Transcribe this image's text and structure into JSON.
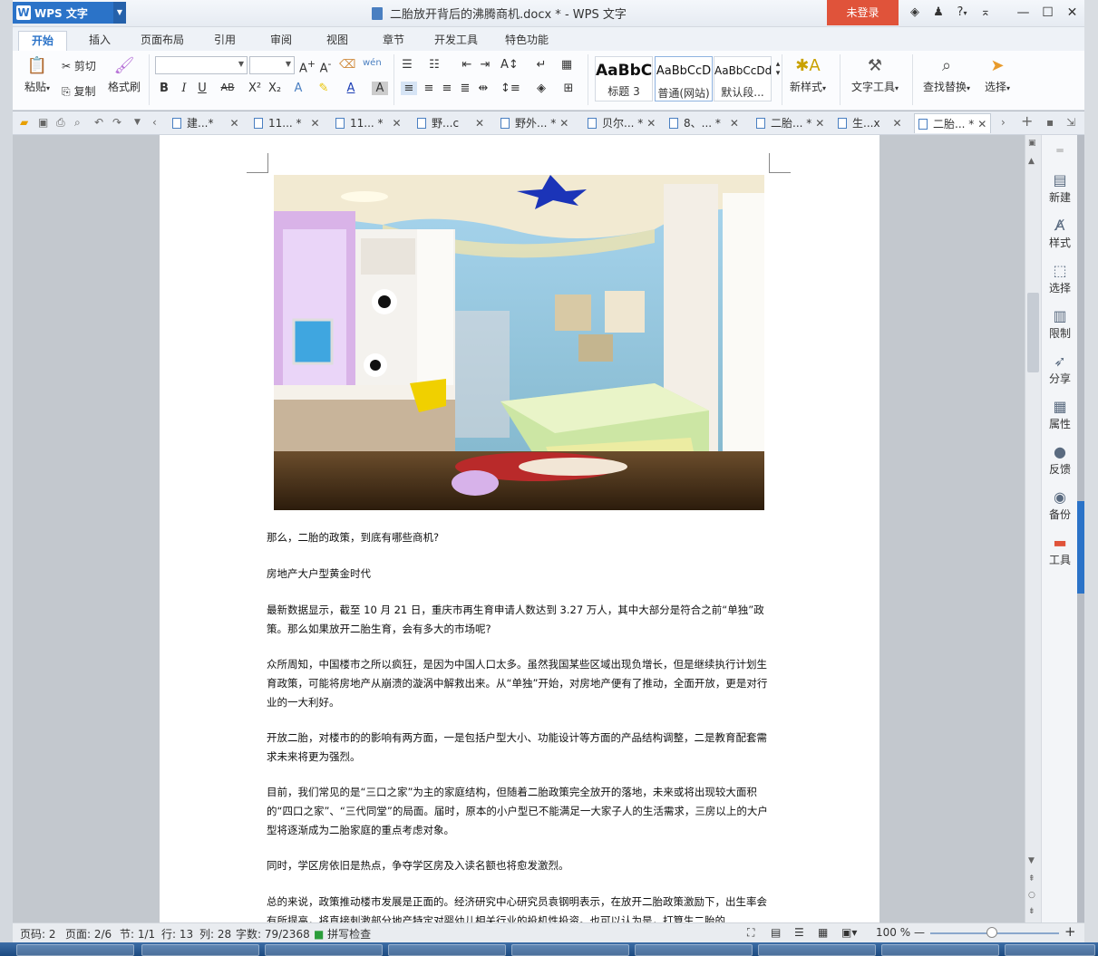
{
  "app": {
    "name": "WPS 文字",
    "doc_title": "二胎放开背后的沸腾商机.docx * - WPS 文字",
    "login_button": "未登录"
  },
  "title_icons": [
    "shield-icon",
    "shirt-icon",
    "help-icon",
    "collapse-ribbon-icon"
  ],
  "help_label": "?",
  "menu": {
    "tabs": [
      "开始",
      "插入",
      "页面布局",
      "引用",
      "审阅",
      "视图",
      "章节",
      "开发工具",
      "特色功能"
    ],
    "active_index": 0
  },
  "ribbon": {
    "clipboard": {
      "paste": "粘贴",
      "cut": "剪切",
      "copy": "复制",
      "format_painter": "格式刷"
    },
    "font_name": "",
    "font_size": "",
    "styles": [
      {
        "preview": "AaBbC",
        "name": "标题 3"
      },
      {
        "preview": "AaBbCcD",
        "name": "普通(网站)"
      },
      {
        "preview": "AaBbCcDd",
        "name": "默认段..."
      }
    ],
    "new_style": "新样式",
    "text_tools": "文字工具",
    "find_replace": "查找替换",
    "select": "选择"
  },
  "doc_tabs": [
    {
      "label": "建...*"
    },
    {
      "label": "11... *"
    },
    {
      "label": "11... *"
    },
    {
      "label": "野...c"
    },
    {
      "label": "野外... *"
    },
    {
      "label": "贝尔... *"
    },
    {
      "label": "8、... *"
    },
    {
      "label": "二胎... *"
    },
    {
      "label": "生...x"
    },
    {
      "label": "二胎... *"
    }
  ],
  "active_doc_tab": 9,
  "document": {
    "paragraphs": [
      "那么，二胎的政策，到底有哪些商机?",
      "房地产大户型黄金时代",
      "最新数据显示，截至 10 月 21 日，重庆市再生育申请人数达到 3.27 万人，其中大部分是符合之前“单独”政策。那么如果放开二胎生育，会有多大的市场呢?",
      "众所周知，中国楼市之所以疯狂，是因为中国人口太多。虽然我国某些区域出现负增长，但是继续执行计划生育政策，可能将房地产从崩溃的漩涡中解救出来。从“单独”开始，对房地产便有了推动，全面开放，更是对行业的一大利好。",
      "开放二胎，对楼市的的影响有两方面，一是包括户型大小、功能设计等方面的产品结构调整，二是教育配套需求未来将更为强烈。",
      "目前，我们常见的是“三口之家”为主的家庭结构，但随着二胎政策完全放开的落地，未来或将出现较大面积的“四口之家”、“三代同堂”的局面。届时，原本的小户型已不能满足一大家子人的生活需求，三房以上的大户型将逐渐成为二胎家庭的重点考虑对象。",
      "同时，学区房依旧是热点，争夺学区房及入读名额也将愈发激烈。",
      "总的来说，政策推动楼市发展是正面的。经济研究中心研究员袁钢明表示，在放开二胎政策激励下，出生率会有所提高，将直接刺激部分地产特定对婴幼儿相关行业的投机性投资。也可以认为是，打算生二胎的"
    ]
  },
  "right_panel": [
    "新建",
    "样式",
    "选择",
    "限制",
    "分享",
    "属性",
    "反馈",
    "备份",
    "工具"
  ],
  "status": {
    "page_code": "页码: 2",
    "pages": "页面: 2/6",
    "section": "节: 1/1",
    "row": "行: 13",
    "col": "列: 28",
    "words": "字数: 79/2368",
    "spell": "拼写检查",
    "zoom": "100 %"
  },
  "colors": {
    "brand_blue": "#2b73c8",
    "login_red": "#e0533a"
  }
}
